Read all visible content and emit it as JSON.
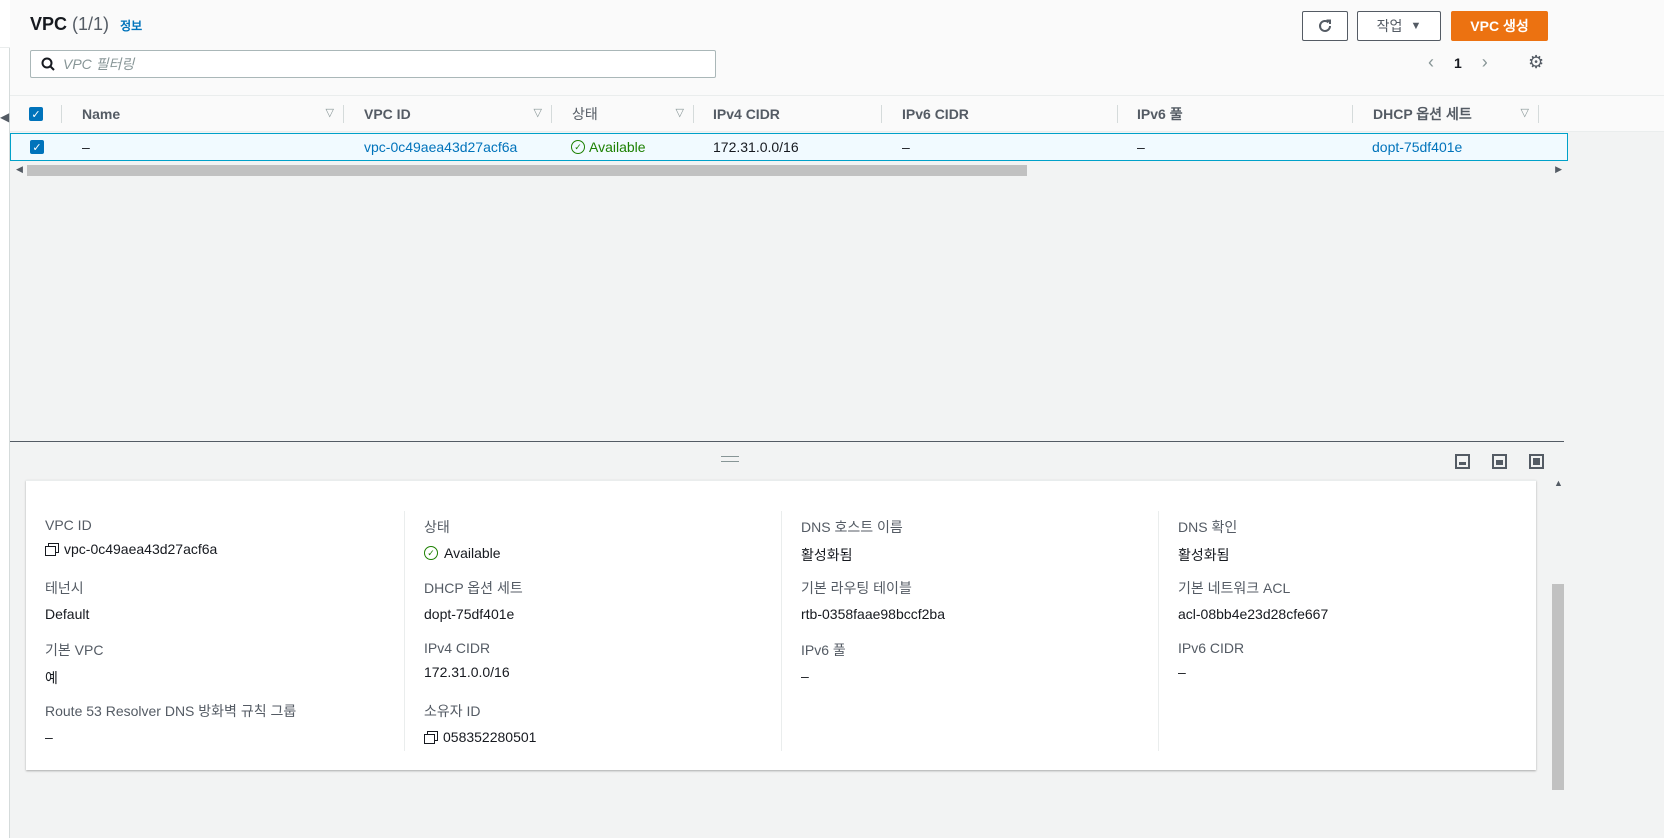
{
  "header": {
    "title": "VPC",
    "count": "(1/1)",
    "info_link": "정보",
    "action_button": "작업",
    "create_button": "VPC 생성"
  },
  "filter": {
    "placeholder": "VPC 필터링"
  },
  "pagination": {
    "current_page": "1"
  },
  "table": {
    "columns": [
      "Name",
      "VPC ID",
      "상태",
      "IPv4 CIDR",
      "IPv6 CIDR",
      "IPv6 풀",
      "DHCP 옵션 세트"
    ],
    "row": {
      "name": "–",
      "vpc_id": "vpc-0c49aea43d27acf6a",
      "status": "Available",
      "ipv4_cidr": "172.31.0.0/16",
      "ipv6_cidr": "–",
      "ipv6_pool": "–",
      "dhcp_options": "dopt-75df401e"
    }
  },
  "details": {
    "vpc_id_label": "VPC ID",
    "vpc_id_value": "vpc-0c49aea43d27acf6a",
    "tenancy_label": "테넌시",
    "tenancy_value": "Default",
    "default_vpc_label": "기본 VPC",
    "default_vpc_value": "예",
    "route53_label": "Route 53 Resolver DNS 방화벽 규칙 그룹",
    "route53_value": "–",
    "status_label": "상태",
    "status_value": "Available",
    "dhcp_label": "DHCP 옵션 세트",
    "dhcp_value": "dopt-75df401e",
    "ipv4_label": "IPv4 CIDR",
    "ipv4_value": "172.31.0.0/16",
    "owner_label": "소유자 ID",
    "owner_value": "058352280501",
    "dns_host_label": "DNS 호스트 이름",
    "dns_host_value": "활성화됨",
    "route_table_label": "기본 라우팅 테이블",
    "route_table_value": "rtb-0358faae98bccf2ba",
    "ipv6_pool_label": "IPv6 풀",
    "ipv6_pool_value": "–",
    "dns_resolution_label": "DNS 확인",
    "dns_resolution_value": "활성화됨",
    "acl_label": "기본 네트워크 ACL",
    "acl_value": "acl-08bb4e23d28cfe667",
    "ipv6_cidr_label": "IPv6 CIDR",
    "ipv6_cidr_value": "–"
  },
  "colors": {
    "primary": "#ec7211",
    "link": "#0073bb",
    "success": "#1d8102",
    "selected_row_bg": "#f1faff",
    "selected_row_border": "#00a1c9"
  },
  "icons": [
    "refresh-icon",
    "caret-down-icon",
    "search-icon",
    "chevron-left-icon",
    "chevron-right-icon",
    "gear-icon",
    "status-ok-icon",
    "copy-icon",
    "checkbox-icon",
    "panel-bottom-icon",
    "panel-half-icon",
    "panel-full-icon"
  ]
}
